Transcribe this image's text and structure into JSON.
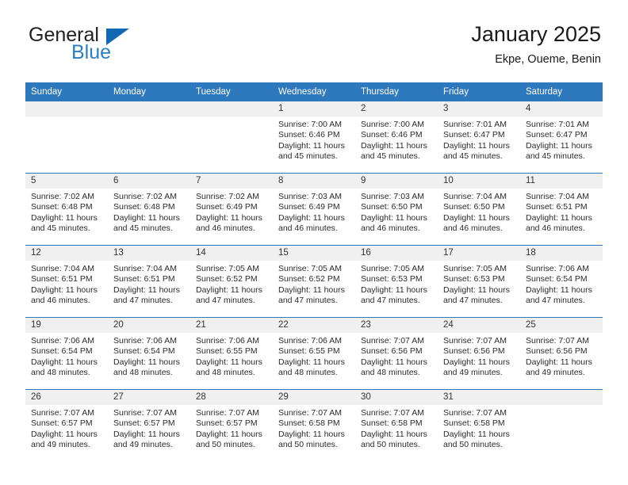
{
  "brand": {
    "name_top": "General",
    "name_bottom": "Blue",
    "triangle_icon": "brand-triangle-icon",
    "color_dark": "#231f20",
    "color_blue": "#2a7fc4",
    "color_triangle": "#1268b3"
  },
  "header": {
    "title": "January 2025",
    "subtitle": "Ekpe, Oueme, Benin"
  },
  "theme": {
    "header_bar": "#2e78bd",
    "daynum_strip": "#f0f0f0",
    "row_divider": "#2e78bd",
    "text": "#2b2b2b"
  },
  "columns": [
    "Sunday",
    "Monday",
    "Tuesday",
    "Wednesday",
    "Thursday",
    "Friday",
    "Saturday"
  ],
  "weeks": [
    [
      {
        "day": "",
        "empty": true
      },
      {
        "day": "",
        "empty": true
      },
      {
        "day": "",
        "empty": true
      },
      {
        "day": "1",
        "sunrise": "Sunrise: 7:00 AM",
        "sunset": "Sunset: 6:46 PM",
        "daylight": "Daylight: 11 hours and 45 minutes."
      },
      {
        "day": "2",
        "sunrise": "Sunrise: 7:00 AM",
        "sunset": "Sunset: 6:46 PM",
        "daylight": "Daylight: 11 hours and 45 minutes."
      },
      {
        "day": "3",
        "sunrise": "Sunrise: 7:01 AM",
        "sunset": "Sunset: 6:47 PM",
        "daylight": "Daylight: 11 hours and 45 minutes."
      },
      {
        "day": "4",
        "sunrise": "Sunrise: 7:01 AM",
        "sunset": "Sunset: 6:47 PM",
        "daylight": "Daylight: 11 hours and 45 minutes."
      }
    ],
    [
      {
        "day": "5",
        "sunrise": "Sunrise: 7:02 AM",
        "sunset": "Sunset: 6:48 PM",
        "daylight": "Daylight: 11 hours and 45 minutes."
      },
      {
        "day": "6",
        "sunrise": "Sunrise: 7:02 AM",
        "sunset": "Sunset: 6:48 PM",
        "daylight": "Daylight: 11 hours and 45 minutes."
      },
      {
        "day": "7",
        "sunrise": "Sunrise: 7:02 AM",
        "sunset": "Sunset: 6:49 PM",
        "daylight": "Daylight: 11 hours and 46 minutes."
      },
      {
        "day": "8",
        "sunrise": "Sunrise: 7:03 AM",
        "sunset": "Sunset: 6:49 PM",
        "daylight": "Daylight: 11 hours and 46 minutes."
      },
      {
        "day": "9",
        "sunrise": "Sunrise: 7:03 AM",
        "sunset": "Sunset: 6:50 PM",
        "daylight": "Daylight: 11 hours and 46 minutes."
      },
      {
        "day": "10",
        "sunrise": "Sunrise: 7:04 AM",
        "sunset": "Sunset: 6:50 PM",
        "daylight": "Daylight: 11 hours and 46 minutes."
      },
      {
        "day": "11",
        "sunrise": "Sunrise: 7:04 AM",
        "sunset": "Sunset: 6:51 PM",
        "daylight": "Daylight: 11 hours and 46 minutes."
      }
    ],
    [
      {
        "day": "12",
        "sunrise": "Sunrise: 7:04 AM",
        "sunset": "Sunset: 6:51 PM",
        "daylight": "Daylight: 11 hours and 46 minutes."
      },
      {
        "day": "13",
        "sunrise": "Sunrise: 7:04 AM",
        "sunset": "Sunset: 6:51 PM",
        "daylight": "Daylight: 11 hours and 47 minutes."
      },
      {
        "day": "14",
        "sunrise": "Sunrise: 7:05 AM",
        "sunset": "Sunset: 6:52 PM",
        "daylight": "Daylight: 11 hours and 47 minutes."
      },
      {
        "day": "15",
        "sunrise": "Sunrise: 7:05 AM",
        "sunset": "Sunset: 6:52 PM",
        "daylight": "Daylight: 11 hours and 47 minutes."
      },
      {
        "day": "16",
        "sunrise": "Sunrise: 7:05 AM",
        "sunset": "Sunset: 6:53 PM",
        "daylight": "Daylight: 11 hours and 47 minutes."
      },
      {
        "day": "17",
        "sunrise": "Sunrise: 7:05 AM",
        "sunset": "Sunset: 6:53 PM",
        "daylight": "Daylight: 11 hours and 47 minutes."
      },
      {
        "day": "18",
        "sunrise": "Sunrise: 7:06 AM",
        "sunset": "Sunset: 6:54 PM",
        "daylight": "Daylight: 11 hours and 47 minutes."
      }
    ],
    [
      {
        "day": "19",
        "sunrise": "Sunrise: 7:06 AM",
        "sunset": "Sunset: 6:54 PM",
        "daylight": "Daylight: 11 hours and 48 minutes."
      },
      {
        "day": "20",
        "sunrise": "Sunrise: 7:06 AM",
        "sunset": "Sunset: 6:54 PM",
        "daylight": "Daylight: 11 hours and 48 minutes."
      },
      {
        "day": "21",
        "sunrise": "Sunrise: 7:06 AM",
        "sunset": "Sunset: 6:55 PM",
        "daylight": "Daylight: 11 hours and 48 minutes."
      },
      {
        "day": "22",
        "sunrise": "Sunrise: 7:06 AM",
        "sunset": "Sunset: 6:55 PM",
        "daylight": "Daylight: 11 hours and 48 minutes."
      },
      {
        "day": "23",
        "sunrise": "Sunrise: 7:07 AM",
        "sunset": "Sunset: 6:56 PM",
        "daylight": "Daylight: 11 hours and 48 minutes."
      },
      {
        "day": "24",
        "sunrise": "Sunrise: 7:07 AM",
        "sunset": "Sunset: 6:56 PM",
        "daylight": "Daylight: 11 hours and 49 minutes."
      },
      {
        "day": "25",
        "sunrise": "Sunrise: 7:07 AM",
        "sunset": "Sunset: 6:56 PM",
        "daylight": "Daylight: 11 hours and 49 minutes."
      }
    ],
    [
      {
        "day": "26",
        "sunrise": "Sunrise: 7:07 AM",
        "sunset": "Sunset: 6:57 PM",
        "daylight": "Daylight: 11 hours and 49 minutes."
      },
      {
        "day": "27",
        "sunrise": "Sunrise: 7:07 AM",
        "sunset": "Sunset: 6:57 PM",
        "daylight": "Daylight: 11 hours and 49 minutes."
      },
      {
        "day": "28",
        "sunrise": "Sunrise: 7:07 AM",
        "sunset": "Sunset: 6:57 PM",
        "daylight": "Daylight: 11 hours and 50 minutes."
      },
      {
        "day": "29",
        "sunrise": "Sunrise: 7:07 AM",
        "sunset": "Sunset: 6:58 PM",
        "daylight": "Daylight: 11 hours and 50 minutes."
      },
      {
        "day": "30",
        "sunrise": "Sunrise: 7:07 AM",
        "sunset": "Sunset: 6:58 PM",
        "daylight": "Daylight: 11 hours and 50 minutes."
      },
      {
        "day": "31",
        "sunrise": "Sunrise: 7:07 AM",
        "sunset": "Sunset: 6:58 PM",
        "daylight": "Daylight: 11 hours and 50 minutes."
      },
      {
        "day": "",
        "empty": true
      }
    ]
  ]
}
